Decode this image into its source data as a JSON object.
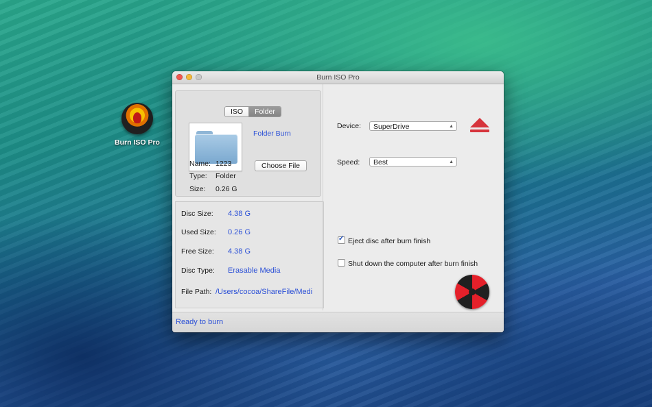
{
  "desktop": {
    "icon_label": "Burn ISO Pro"
  },
  "window": {
    "title": "Burn ISO Pro"
  },
  "source": {
    "tabs": [
      {
        "label": "ISO",
        "selected": false
      },
      {
        "label": "Folder",
        "selected": true
      }
    ],
    "mode_title": "Folder Burn",
    "choose_button": "Choose File",
    "info": [
      {
        "label": "Name:",
        "value": "1223"
      },
      {
        "label": "Type:",
        "value": "Folder"
      },
      {
        "label": "Size:",
        "value": "0.26 G"
      }
    ]
  },
  "stats": [
    {
      "label": "Disc Size:",
      "value": "4.38 G"
    },
    {
      "label": "Used Size:",
      "value": "0.26 G"
    },
    {
      "label": "Free Size:",
      "value": "4.38 G"
    },
    {
      "label": "Disc Type:",
      "value": "Erasable Media"
    },
    {
      "label": "File Path:",
      "value": "/Users/cocoa/ShareFile/Medi"
    }
  ],
  "device": {
    "label": "Device:",
    "value": "SuperDrive"
  },
  "speed": {
    "label": "Speed:",
    "value": "Best"
  },
  "options": [
    {
      "label": "Eject disc after burn finish",
      "checked": true
    },
    {
      "label": "Shut down the computer after burn finish",
      "checked": false
    }
  ],
  "status": "Ready to burn",
  "icons": [
    "close-icon",
    "minimize-icon",
    "zoom-icon",
    "folder-icon",
    "eject-icon",
    "burn-icon",
    "popup-arrows-icon",
    "checkbox-icon"
  ],
  "colors": {
    "accent": "#2a4fd6",
    "eject": "#d6343c",
    "burn_red": "#e4202a"
  }
}
